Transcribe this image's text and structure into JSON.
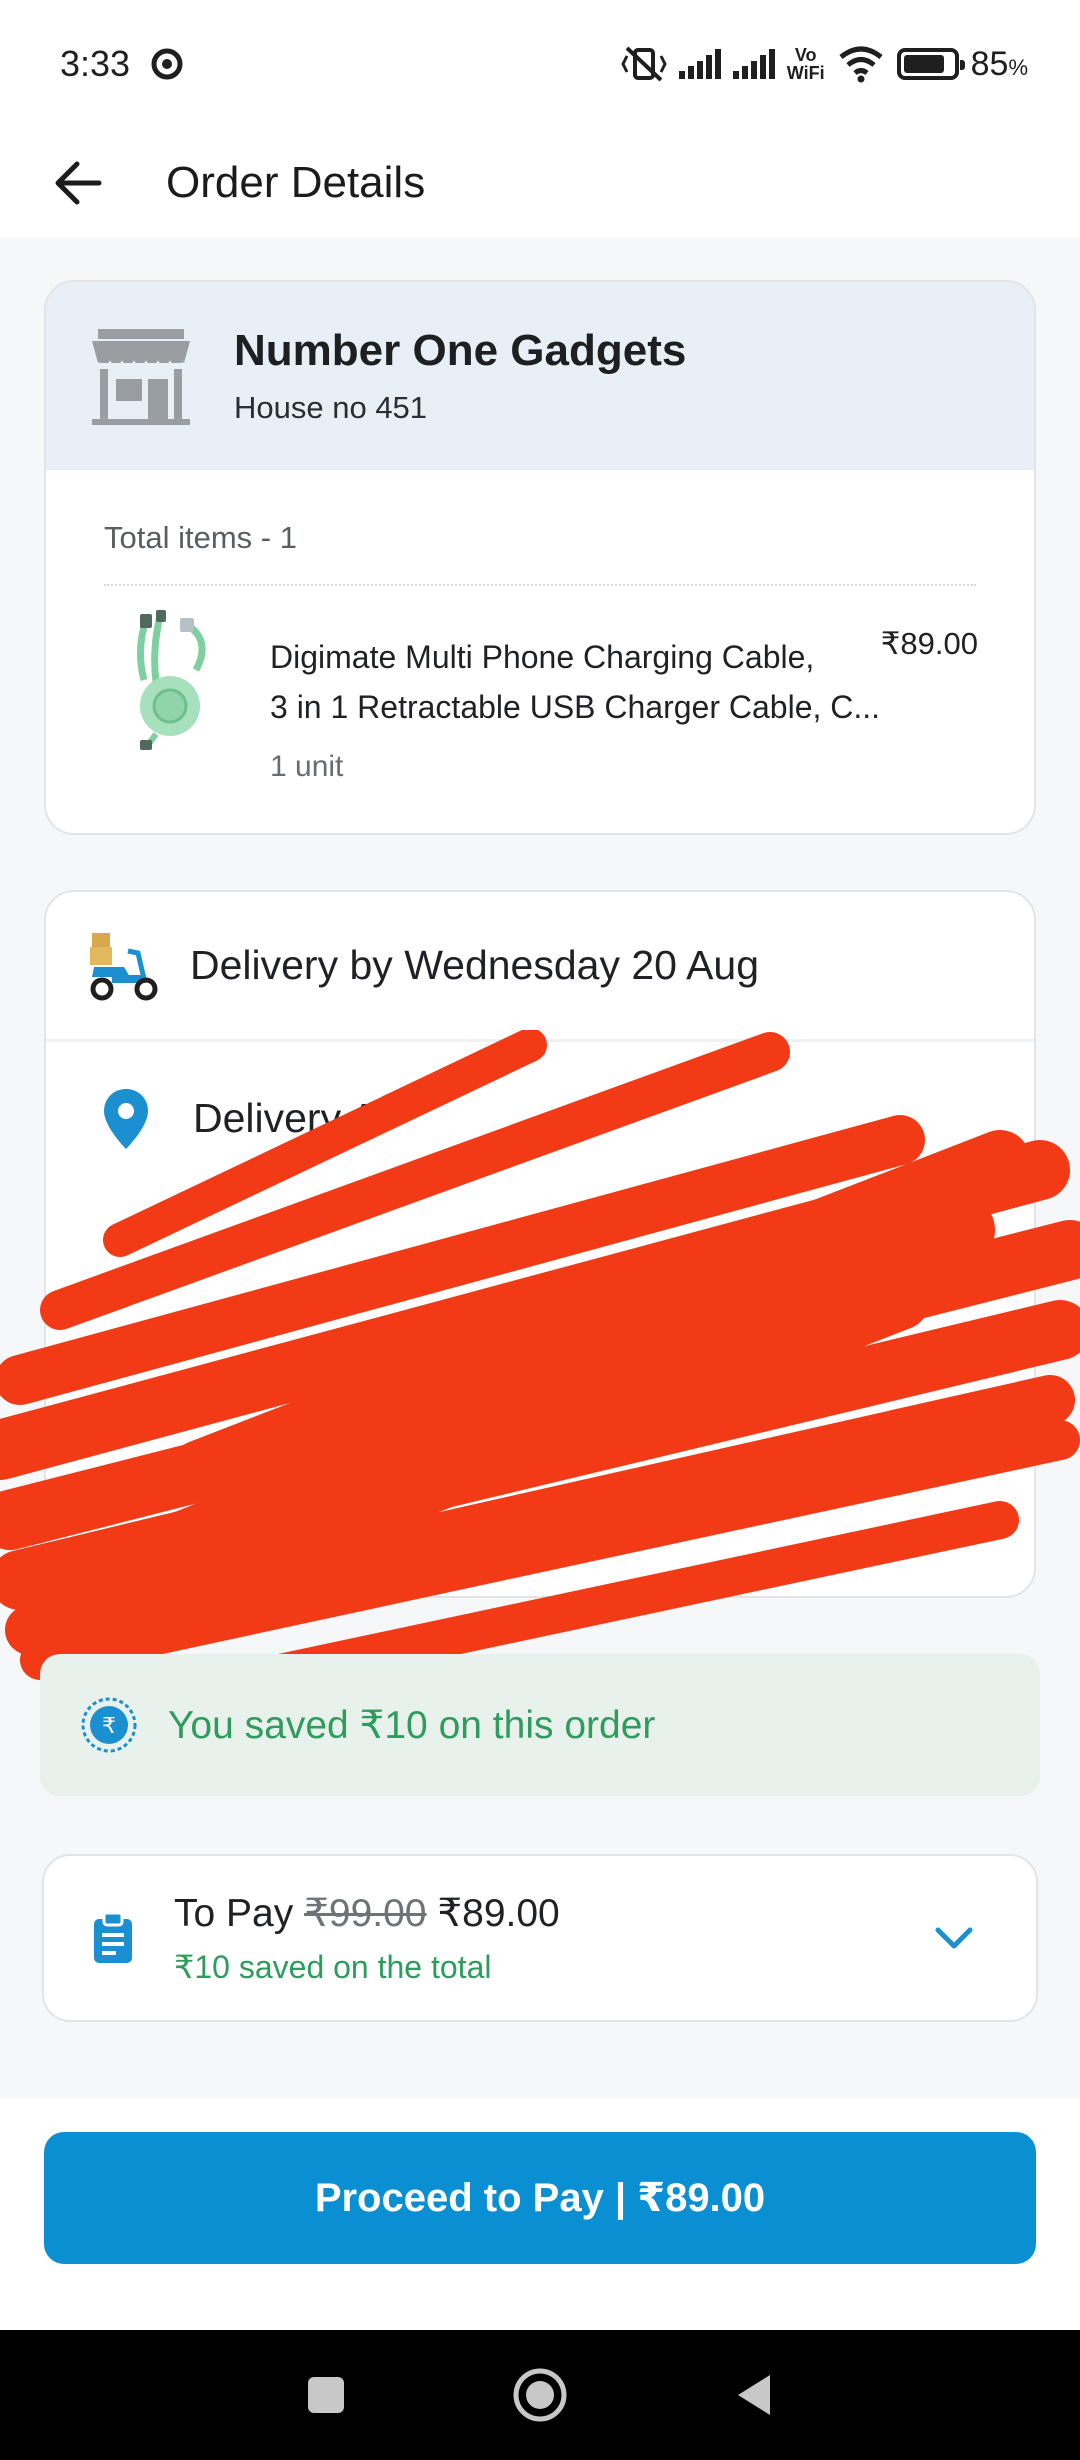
{
  "status_bar": {
    "time": "3:33",
    "vowifi_top": "Vo",
    "vowifi_bottom": "WiFi",
    "battery_percent": "85",
    "battery_unit": "%",
    "battery_level": 0.85,
    "icons": [
      "vpn-shield-icon",
      "mute-vibrate-icon",
      "signal-icon",
      "signal-icon",
      "wifi-icon",
      "battery-icon"
    ]
  },
  "header": {
    "title": "Order Details"
  },
  "store": {
    "name": "Number One Gadgets",
    "address": "House no 451",
    "total_items_label": "Total items - 1",
    "items": [
      {
        "name_line1": "Digimate Multi Phone Charging Cable,",
        "name_line2": "3 in 1 Retractable USB Charger Cable, C...",
        "quantity": "1 unit",
        "price": "₹89.00"
      }
    ]
  },
  "delivery": {
    "prefix": "Delivery by",
    "date": "Wednesday 20 Aug",
    "address_title": "Delivery A"
  },
  "savings": {
    "text": "You saved ₹10 on this order"
  },
  "to_pay": {
    "label": "To Pay",
    "original_price": "₹99.00",
    "final_price": "₹89.00",
    "saved_text": "₹10 saved on the total"
  },
  "proceed_button": {
    "label": "Proceed to Pay | ₹89.00"
  },
  "colors": {
    "accent": "#0a8fd2",
    "savings_green": "#2e9c5c",
    "store_header_bg": "#e8eff6",
    "savings_bg": "#e8f1ec",
    "redaction": "#f23a17"
  }
}
